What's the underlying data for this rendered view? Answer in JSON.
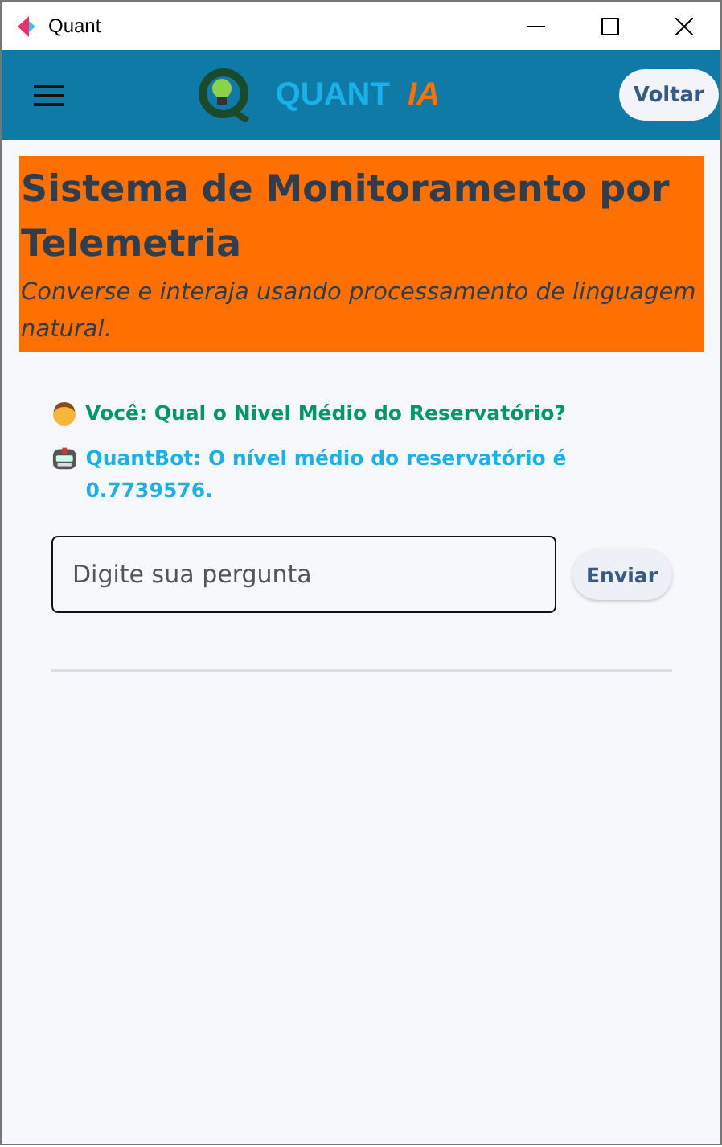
{
  "window": {
    "title": "Quant"
  },
  "app_bar": {
    "brand": "QUANT",
    "brand_suffix": "IA",
    "back_button": "Voltar"
  },
  "header": {
    "title": "Sistema de Monitoramento por Telemetria",
    "subtitle": "Converse e interaja usando processamento de linguagem natural."
  },
  "messages": [
    {
      "kind": "user",
      "text": "Você: Qual o Nivel Médio do Reservatório?",
      "color": "#009966"
    },
    {
      "kind": "bot",
      "text": "QuantBot: O nível médio do reservatório é 0.7739576.",
      "color": "#1ab0ea"
    }
  ],
  "input": {
    "placeholder": "Digite sua pergunta"
  },
  "send_button": "Enviar"
}
